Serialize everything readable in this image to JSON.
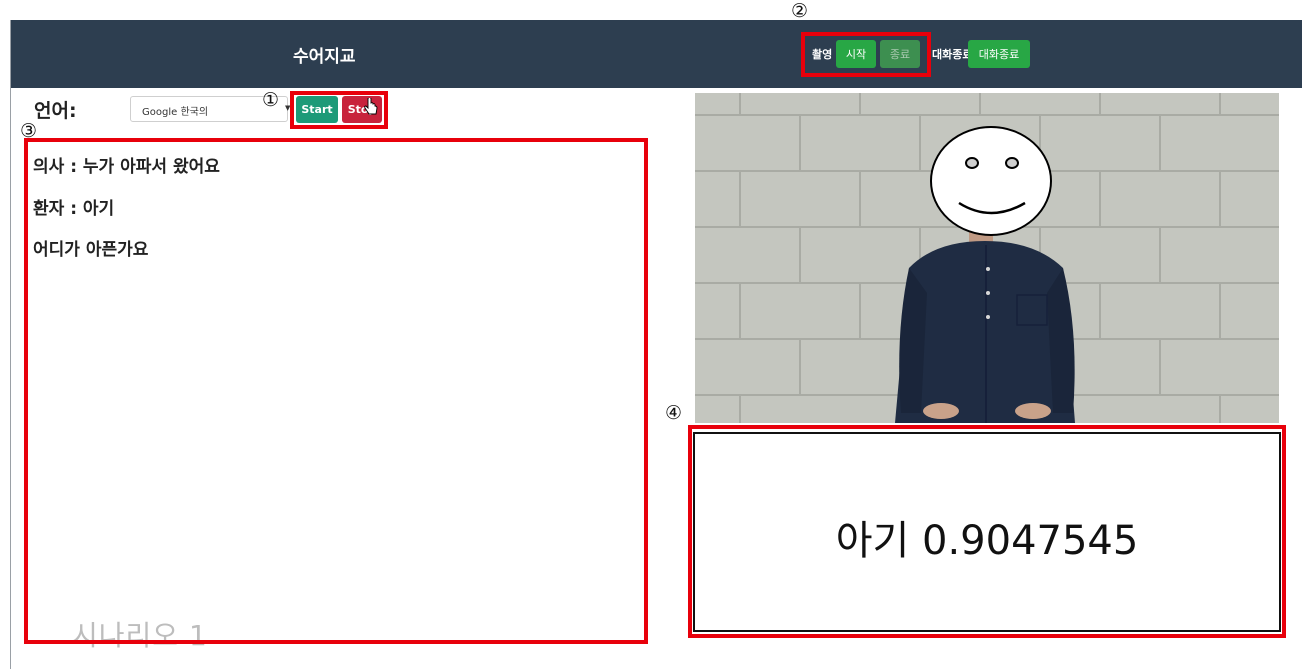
{
  "header": {
    "title": "수어지교",
    "record_label": "촬영",
    "record_start_label": "시작",
    "record_stop_label": "종료",
    "end_chat_text": "대화종료",
    "end_chat_button_label": "대화종료"
  },
  "language": {
    "label": "언어:",
    "selected": "Google 한국의",
    "start_label": "Start",
    "stop_label": "Stop"
  },
  "transcript": [
    "의사 : 누가 아파서 왔어요",
    "환자 : 아기",
    "어디가 아픈가요"
  ],
  "result": {
    "text": "아기 0.9047545"
  },
  "scenario": "시나리오 1",
  "markers": [
    "①",
    "②",
    "③",
    "④"
  ],
  "colors": {
    "header_bg": "#2d3e50",
    "highlight_red": "#e8000b",
    "green": "#28a745",
    "teal": "#1d9a78",
    "stop_red": "#c8233c"
  }
}
